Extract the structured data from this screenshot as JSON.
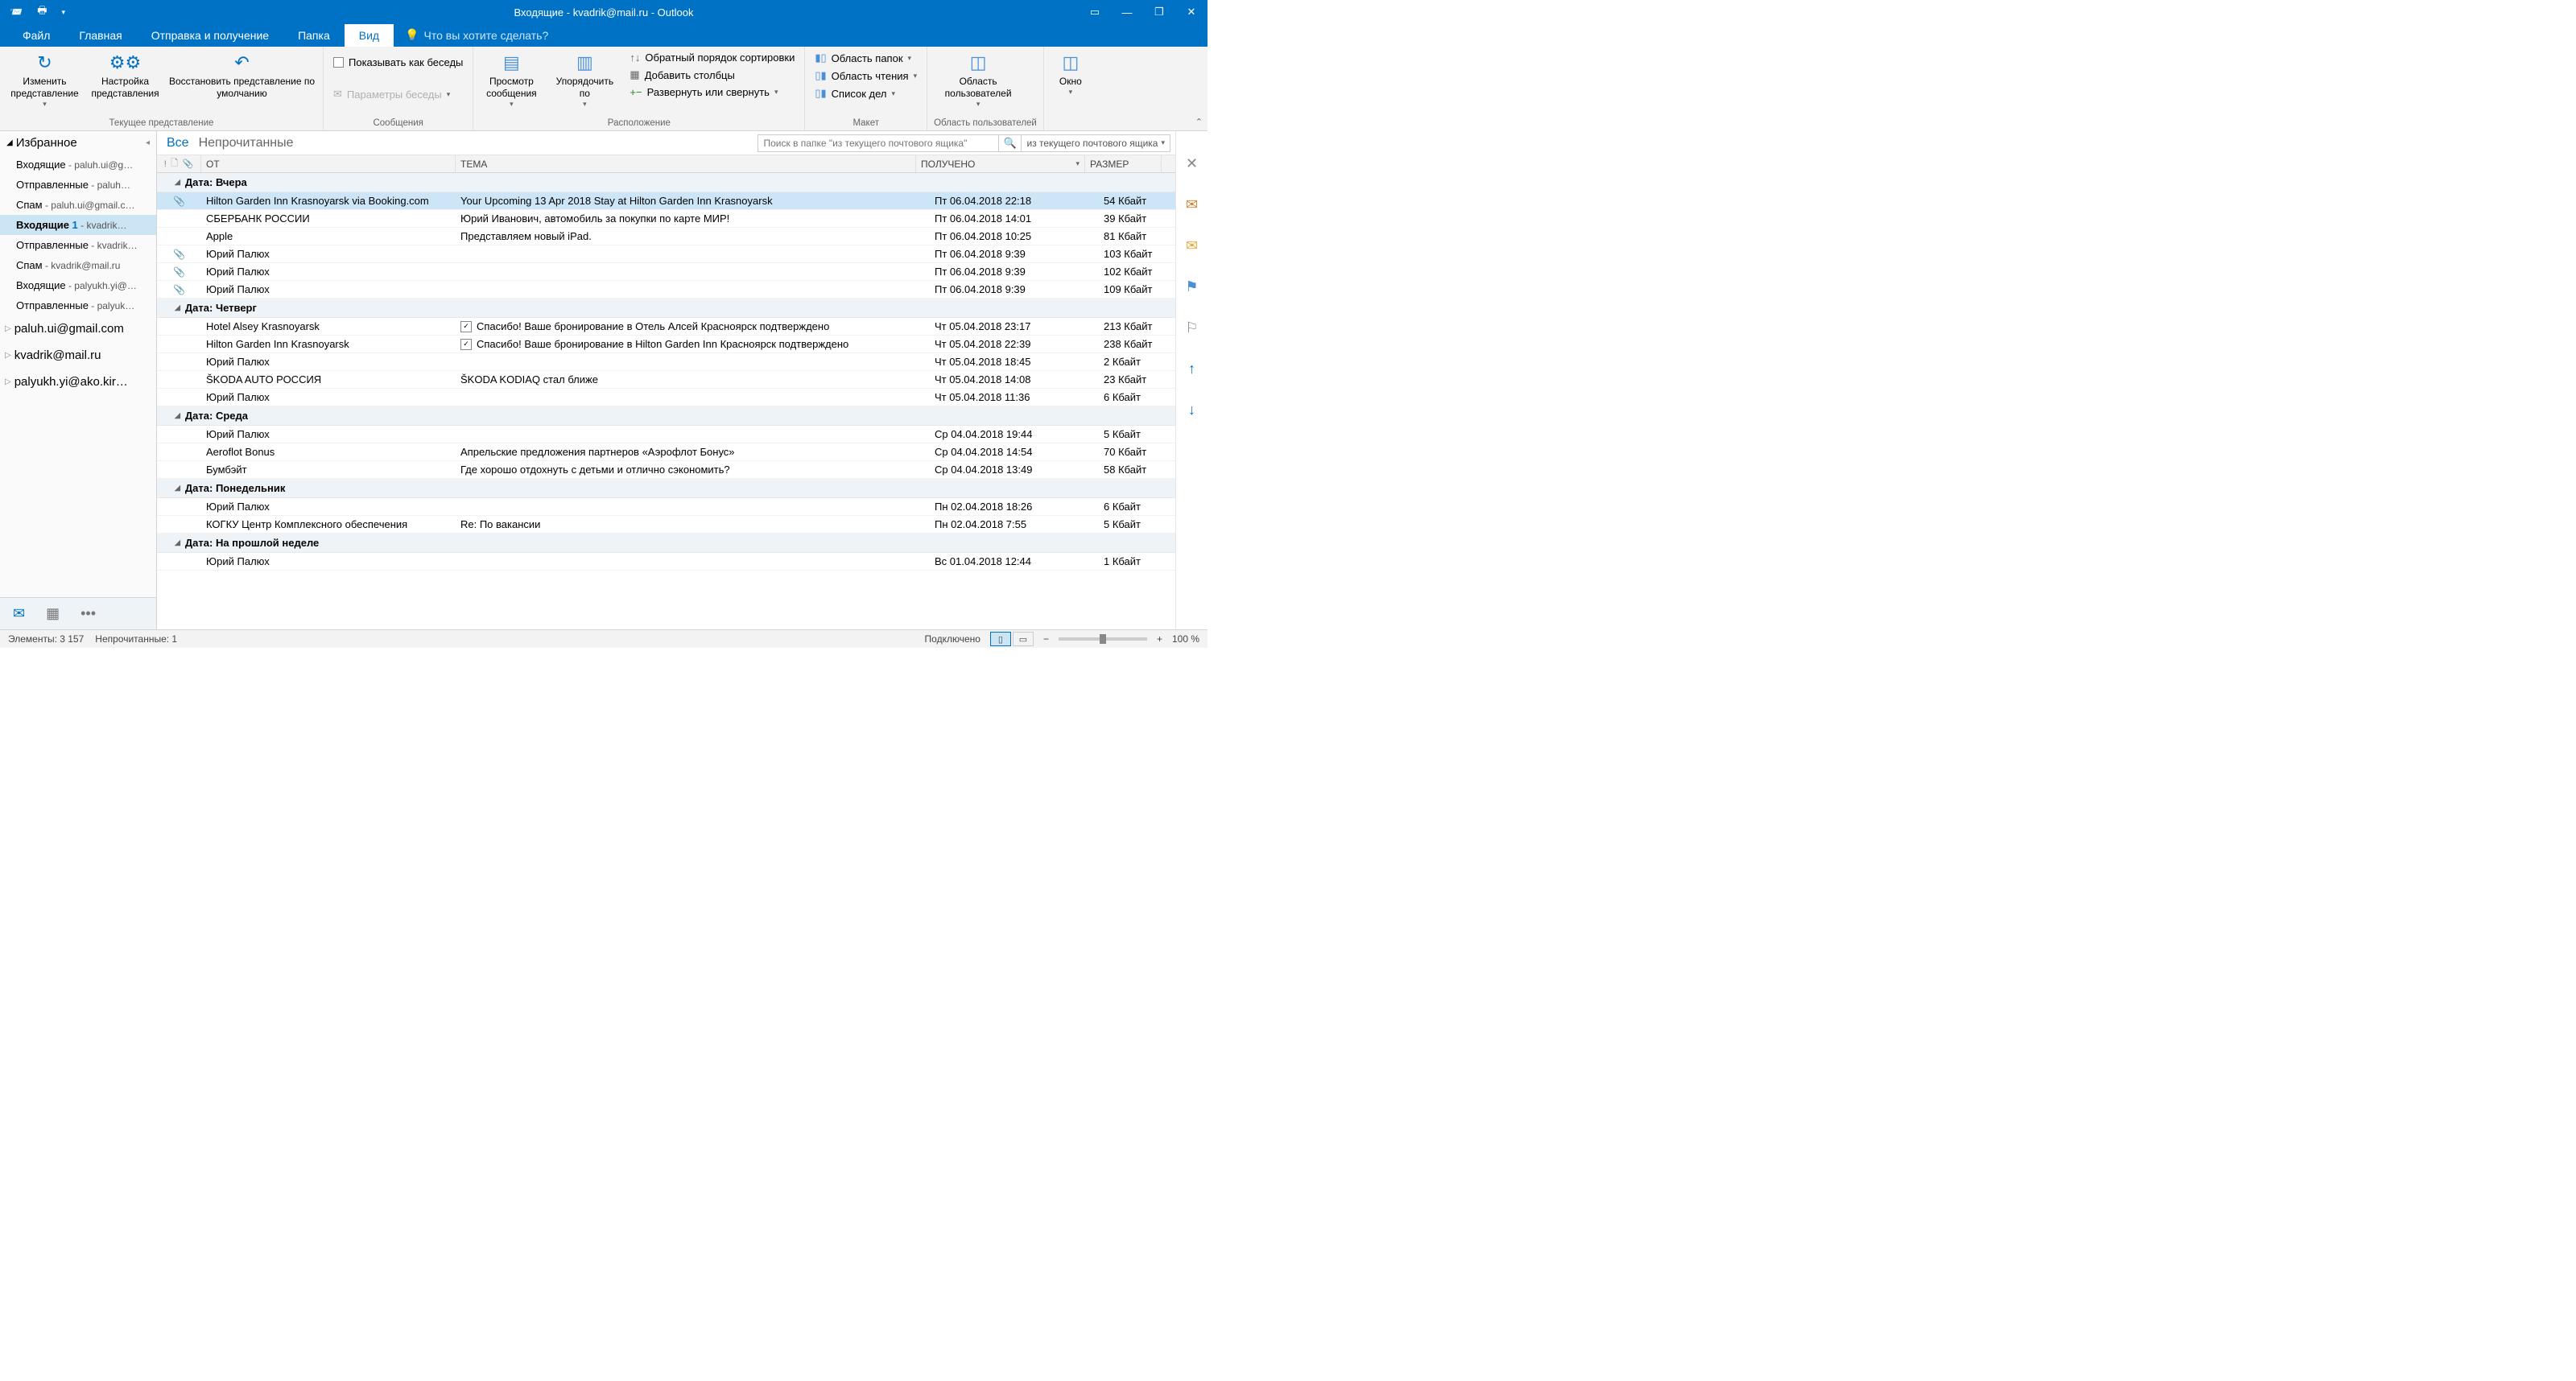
{
  "window_title": "Входящие - kvadrik@mail.ru  -  Outlook",
  "menu": {
    "file": "Файл",
    "home": "Главная",
    "sendrecv": "Отправка и получение",
    "folder": "Папка",
    "view": "Вид",
    "tell_me": "Что вы хотите сделать?"
  },
  "ribbon": {
    "group1_label": "Текущее представление",
    "change_view": "Изменить представление",
    "view_settings": "Настройка представления",
    "reset_view": "Восстановить представление по умолчанию",
    "group2_label": "Сообщения",
    "show_conv": "Показывать как беседы",
    "conv_settings": "Параметры беседы",
    "group3_label": "Расположение",
    "msg_preview": "Просмотр сообщения",
    "arrange": "Упорядочить по",
    "reverse_sort": "Обратный порядок сортировки",
    "add_cols": "Добавить столбцы",
    "expand": "Развернуть или свернуть",
    "group4_label": "Макет",
    "folder_pane": "Область папок",
    "reading_pane": "Область чтения",
    "todo_list": "Список дел",
    "group5_label": "Область пользователей",
    "people_pane": "Область пользователей",
    "group6_label": "",
    "window": "Окно"
  },
  "folders": {
    "favorites": "Избранное",
    "items": [
      {
        "name": "Входящие",
        "suffix": " - paluh.ui@g…"
      },
      {
        "name": "Отправленные",
        "suffix": " - paluh…"
      },
      {
        "name": "Спам",
        "suffix": " - paluh.ui@gmail.c…"
      },
      {
        "name": "Входящие  ",
        "count": "1",
        "suffix": " - kvadrik…",
        "selected": true
      },
      {
        "name": "Отправленные",
        "suffix": " - kvadrik…"
      },
      {
        "name": "Спам",
        "suffix": " - kvadrik@mail.ru"
      },
      {
        "name": "Входящие",
        "suffix": " - palyukh.yi@…"
      },
      {
        "name": "Отправленные",
        "suffix": " - palyuk…"
      }
    ],
    "accounts": [
      "paluh.ui@gmail.com",
      "kvadrik@mail.ru",
      "palyukh.yi@ako.kir…"
    ]
  },
  "filter": {
    "all": "Все",
    "unread": "Непрочитанные",
    "search_ph": "Поиск в папке \"из текущего почтового ящика\"",
    "scope": "из текущего почтового ящика"
  },
  "cols": {
    "from": "ОТ",
    "subject": "ТЕМА",
    "received": "ПОЛУЧЕНО",
    "size": "РАЗМЕР"
  },
  "groups": [
    {
      "label": "Дата: Вчера",
      "rows": [
        {
          "att": true,
          "from": "Hilton Garden Inn Krasnoyarsk via Booking.com",
          "subj": "Your Upcoming 13 Apr 2018 Stay at Hilton Garden Inn Krasnoyarsk",
          "recv": "Пт 06.04.2018 22:18",
          "size": "54 Кбайт",
          "selected": true
        },
        {
          "from": "СБЕРБАНК РОССИИ",
          "subj": "Юрий Иванович, автомобиль за покупки по карте МИР!",
          "recv": "Пт 06.04.2018 14:01",
          "size": "39 Кбайт"
        },
        {
          "from": "Apple",
          "subj": "Представляем новый iPad.",
          "recv": "Пт 06.04.2018 10:25",
          "size": "81 Кбайт"
        },
        {
          "att": true,
          "from": "Юрий Палюх",
          "subj": "",
          "recv": "Пт 06.04.2018 9:39",
          "size": "103 Кбайт"
        },
        {
          "att": true,
          "from": "Юрий Палюх",
          "subj": "",
          "recv": "Пт 06.04.2018 9:39",
          "size": "102 Кбайт"
        },
        {
          "att": true,
          "from": "Юрий Палюх",
          "subj": "",
          "recv": "Пт 06.04.2018 9:39",
          "size": "109 Кбайт"
        }
      ]
    },
    {
      "label": "Дата: Четверг",
      "rows": [
        {
          "from": "Hotel Alsey Krasnoyarsk",
          "badge": true,
          "subj": "Спасибо! Ваше бронирование в Отель Алсей Красноярск подтверждено",
          "recv": "Чт 05.04.2018 23:17",
          "size": "213 Кбайт"
        },
        {
          "from": "Hilton Garden Inn Krasnoyarsk",
          "badge": true,
          "subj": "Спасибо! Ваше бронирование в Hilton Garden Inn Красноярск подтверждено",
          "recv": "Чт 05.04.2018 22:39",
          "size": "238 Кбайт"
        },
        {
          "from": "Юрий Палюх",
          "subj": "",
          "recv": "Чт 05.04.2018 18:45",
          "size": "2 Кбайт"
        },
        {
          "from": "ŠKODA AUTO РОССИЯ",
          "subj": "ŠKODA KODIAQ стал ближе",
          "recv": "Чт 05.04.2018 14:08",
          "size": "23 Кбайт"
        },
        {
          "from": "Юрий Палюх",
          "subj": "",
          "recv": "Чт 05.04.2018 11:36",
          "size": "6 Кбайт"
        }
      ]
    },
    {
      "label": "Дата: Среда",
      "rows": [
        {
          "from": "Юрий Палюх",
          "subj": "",
          "recv": "Ср 04.04.2018 19:44",
          "size": "5 Кбайт"
        },
        {
          "from": "Aeroflot Bonus",
          "subj": "Апрельские предложения партнеров «Аэрофлот Бонус»",
          "recv": "Ср 04.04.2018 14:54",
          "size": "70 Кбайт"
        },
        {
          "from": "Бумбэйт",
          "subj": "Где хорошо отдохнуть с детьми и отлично сэкономить?",
          "recv": "Ср 04.04.2018 13:49",
          "size": "58 Кбайт"
        }
      ]
    },
    {
      "label": "Дата: Понедельник",
      "rows": [
        {
          "from": "Юрий Палюх",
          "subj": "",
          "recv": "Пн 02.04.2018 18:26",
          "size": "6 Кбайт"
        },
        {
          "from": "КОГКУ Центр Комплексного обеспечения",
          "subj": "Re: По вакансии",
          "recv": "Пн 02.04.2018 7:55",
          "size": "5 Кбайт"
        }
      ]
    },
    {
      "label": "Дата: На прошлой неделе",
      "rows": [
        {
          "from": "Юрий Палюх",
          "subj": "",
          "recv": "Вс 01.04.2018 12:44",
          "size": "1 Кбайт"
        }
      ]
    }
  ],
  "status": {
    "items": "Элементы: 3 157",
    "unread": "Непрочитанные: 1",
    "connected": "Подключено",
    "zoom": "100 %"
  }
}
